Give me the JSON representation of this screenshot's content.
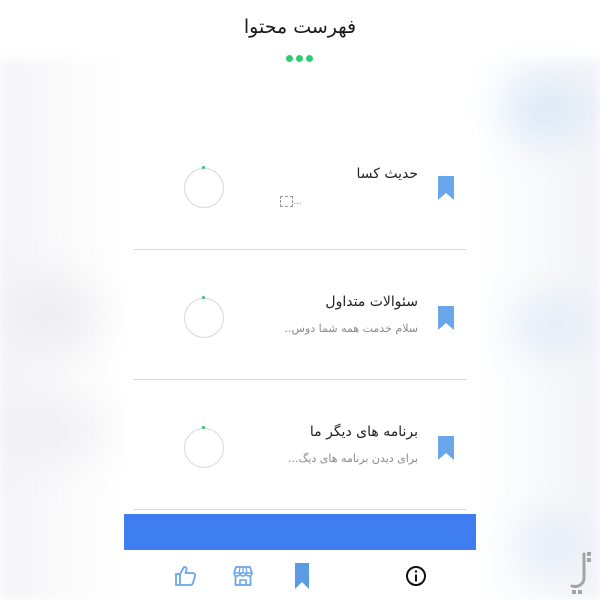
{
  "header": {
    "title": "فهرست محتوا"
  },
  "colors": {
    "accent": "#2ecc71",
    "bookmark": "#6aa6ea",
    "bottom_bar": "#3f7ef0",
    "divider": "#d6d6d6"
  },
  "items": [
    {
      "title": "حدیث کسا",
      "subtitle": "...",
      "icon": "bookmark-icon"
    },
    {
      "title": "سئوالات متداول",
      "subtitle": "سلام خدمت همه شما دوس..",
      "icon": "bookmark-icon"
    },
    {
      "title": "برنامه های دیگر ما",
      "subtitle": "برای دیدن برنامه های دیگ...",
      "icon": "bookmark-icon"
    }
  ],
  "tabs": [
    {
      "name": "like-icon"
    },
    {
      "name": "store-icon"
    },
    {
      "name": "bookmark-icon"
    },
    {
      "name": "info-icon"
    }
  ]
}
